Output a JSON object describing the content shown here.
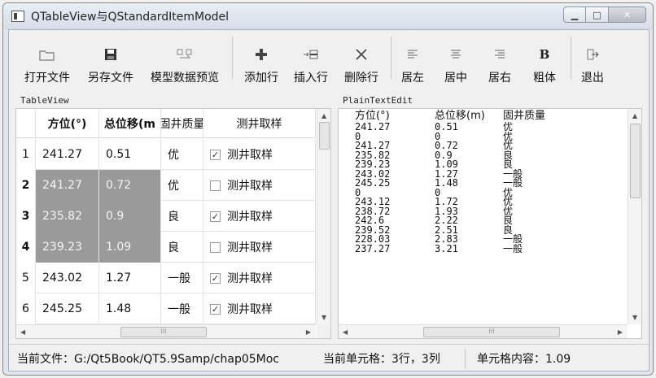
{
  "window": {
    "title": "QTableView与QStandardItemModel"
  },
  "toolbar": {
    "items": [
      {
        "label": "打开文件",
        "icon": "folder-open-icon"
      },
      {
        "label": "另存文件",
        "icon": "save-icon"
      },
      {
        "label": "模型数据预览",
        "icon": "preview-icon"
      },
      {
        "label": "添加行",
        "icon": "plus-icon"
      },
      {
        "label": "插入行",
        "icon": "insert-row-icon"
      },
      {
        "label": "删除行",
        "icon": "delete-icon"
      },
      {
        "label": "居左",
        "icon": "align-left-icon"
      },
      {
        "label": "居中",
        "icon": "align-center-icon"
      },
      {
        "label": "居右",
        "icon": "align-right-icon"
      },
      {
        "label": "粗体",
        "icon": "bold-icon"
      },
      {
        "label": "退出",
        "icon": "exit-icon"
      }
    ]
  },
  "table_view": {
    "title": "TableView",
    "headers": [
      "方位(°)",
      "总位移(m",
      "固井质量",
      "测井取样"
    ],
    "rows": [
      {
        "num": "1",
        "azimuth": "241.27",
        "displacement": "0.51",
        "quality": "优",
        "checked": true,
        "sample": "测井取样",
        "selected": false
      },
      {
        "num": "2",
        "azimuth": "241.27",
        "displacement": "0.72",
        "quality": "优",
        "checked": false,
        "sample": "测井取样",
        "selected": true
      },
      {
        "num": "3",
        "azimuth": "235.82",
        "displacement": "0.9",
        "quality": "良",
        "checked": true,
        "sample": "测井取样",
        "selected": true
      },
      {
        "num": "4",
        "azimuth": "239.23",
        "displacement": "1.09",
        "quality": "良",
        "checked": false,
        "sample": "测井取样",
        "selected": true
      },
      {
        "num": "5",
        "azimuth": "243.02",
        "displacement": "1.27",
        "quality": "一般",
        "checked": true,
        "sample": "测井取样",
        "selected": false
      },
      {
        "num": "6",
        "azimuth": "245.25",
        "displacement": "1.48",
        "quality": "一般",
        "checked": true,
        "sample": "测井取样",
        "selected": false
      }
    ]
  },
  "plain_text": {
    "title": "PlainTextEdit",
    "header": [
      "方位(°)",
      "总位移(m)",
      "固井质量"
    ],
    "lines": [
      [
        "241.27",
        "0.51",
        "优"
      ],
      [
        "0",
        "0",
        "优"
      ],
      [
        "241.27",
        "0.72",
        "优"
      ],
      [
        "235.82",
        "0.9",
        "良"
      ],
      [
        "239.23",
        "1.09",
        "良"
      ],
      [
        "243.02",
        "1.27",
        "一般"
      ],
      [
        "245.25",
        "1.48",
        "一般"
      ],
      [
        "0",
        "0",
        "优"
      ],
      [
        "243.12",
        "1.72",
        "优"
      ],
      [
        "238.72",
        "1.93",
        "优"
      ],
      [
        "242.6",
        "2.22",
        "良"
      ],
      [
        "239.52",
        "2.51",
        "良"
      ],
      [
        "228.03",
        "2.83",
        "一般"
      ],
      [
        "237.27",
        "3.21",
        "一般"
      ]
    ]
  },
  "status": {
    "file": "当前文件：G:/Qt5Book/QT5.9Samp/chap05Moc",
    "cell": "当前单元格：3行，3列",
    "content": "单元格内容：1.09"
  }
}
